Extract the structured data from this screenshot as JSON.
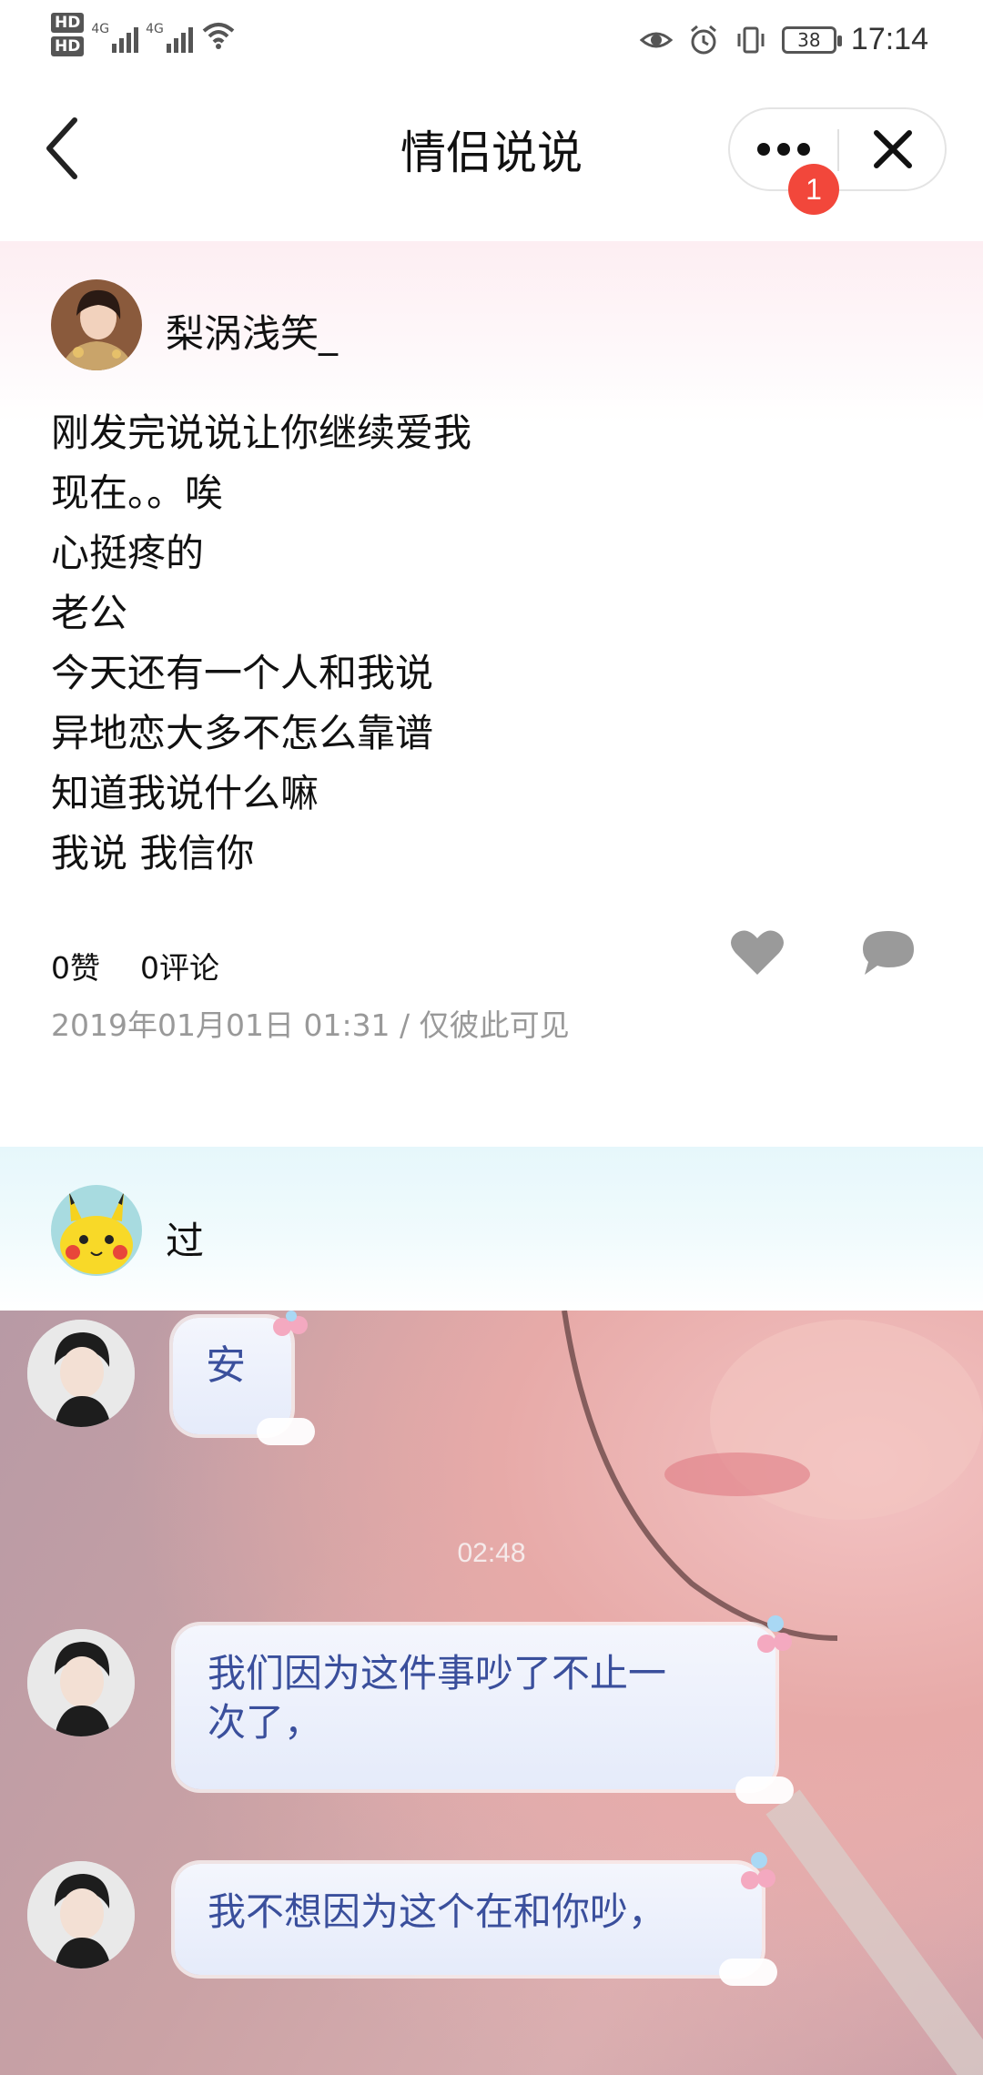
{
  "status_bar": {
    "hd1": "HD",
    "hd2": "HD",
    "net1": "4G",
    "net2": "4G",
    "battery": "38",
    "time": "17:14"
  },
  "nav": {
    "title": "情侣说说",
    "badge_count": "1"
  },
  "post1": {
    "username": "梨涡浅笑_",
    "lines": [
      "刚发完说说让你继续爱我",
      "现在。。唉",
      "心挺疼的",
      "老公",
      "今天还有一个人和我说",
      "异地恋大多不怎么靠谱",
      "知道我说什么嘛",
      "我说 我信你"
    ],
    "likes": "0赞",
    "comments": "0评论",
    "meta": "2019年01月01日 01:31 / 仅彼此可见"
  },
  "post2": {
    "username": "过",
    "chat": {
      "bubble1": "安",
      "time": "02:48",
      "bubble2_line1": "我们因为这件事吵了不止一",
      "bubble2_line2": "次了，",
      "bubble3": "我不想因为这个在和你吵，"
    }
  },
  "colors": {
    "badge": "#f2473b",
    "bubble_text": "#3a4f9c",
    "meta_text": "#999999",
    "post1_header_bg": "#fdeef2",
    "post2_header_bg": "#e6f7fb"
  }
}
